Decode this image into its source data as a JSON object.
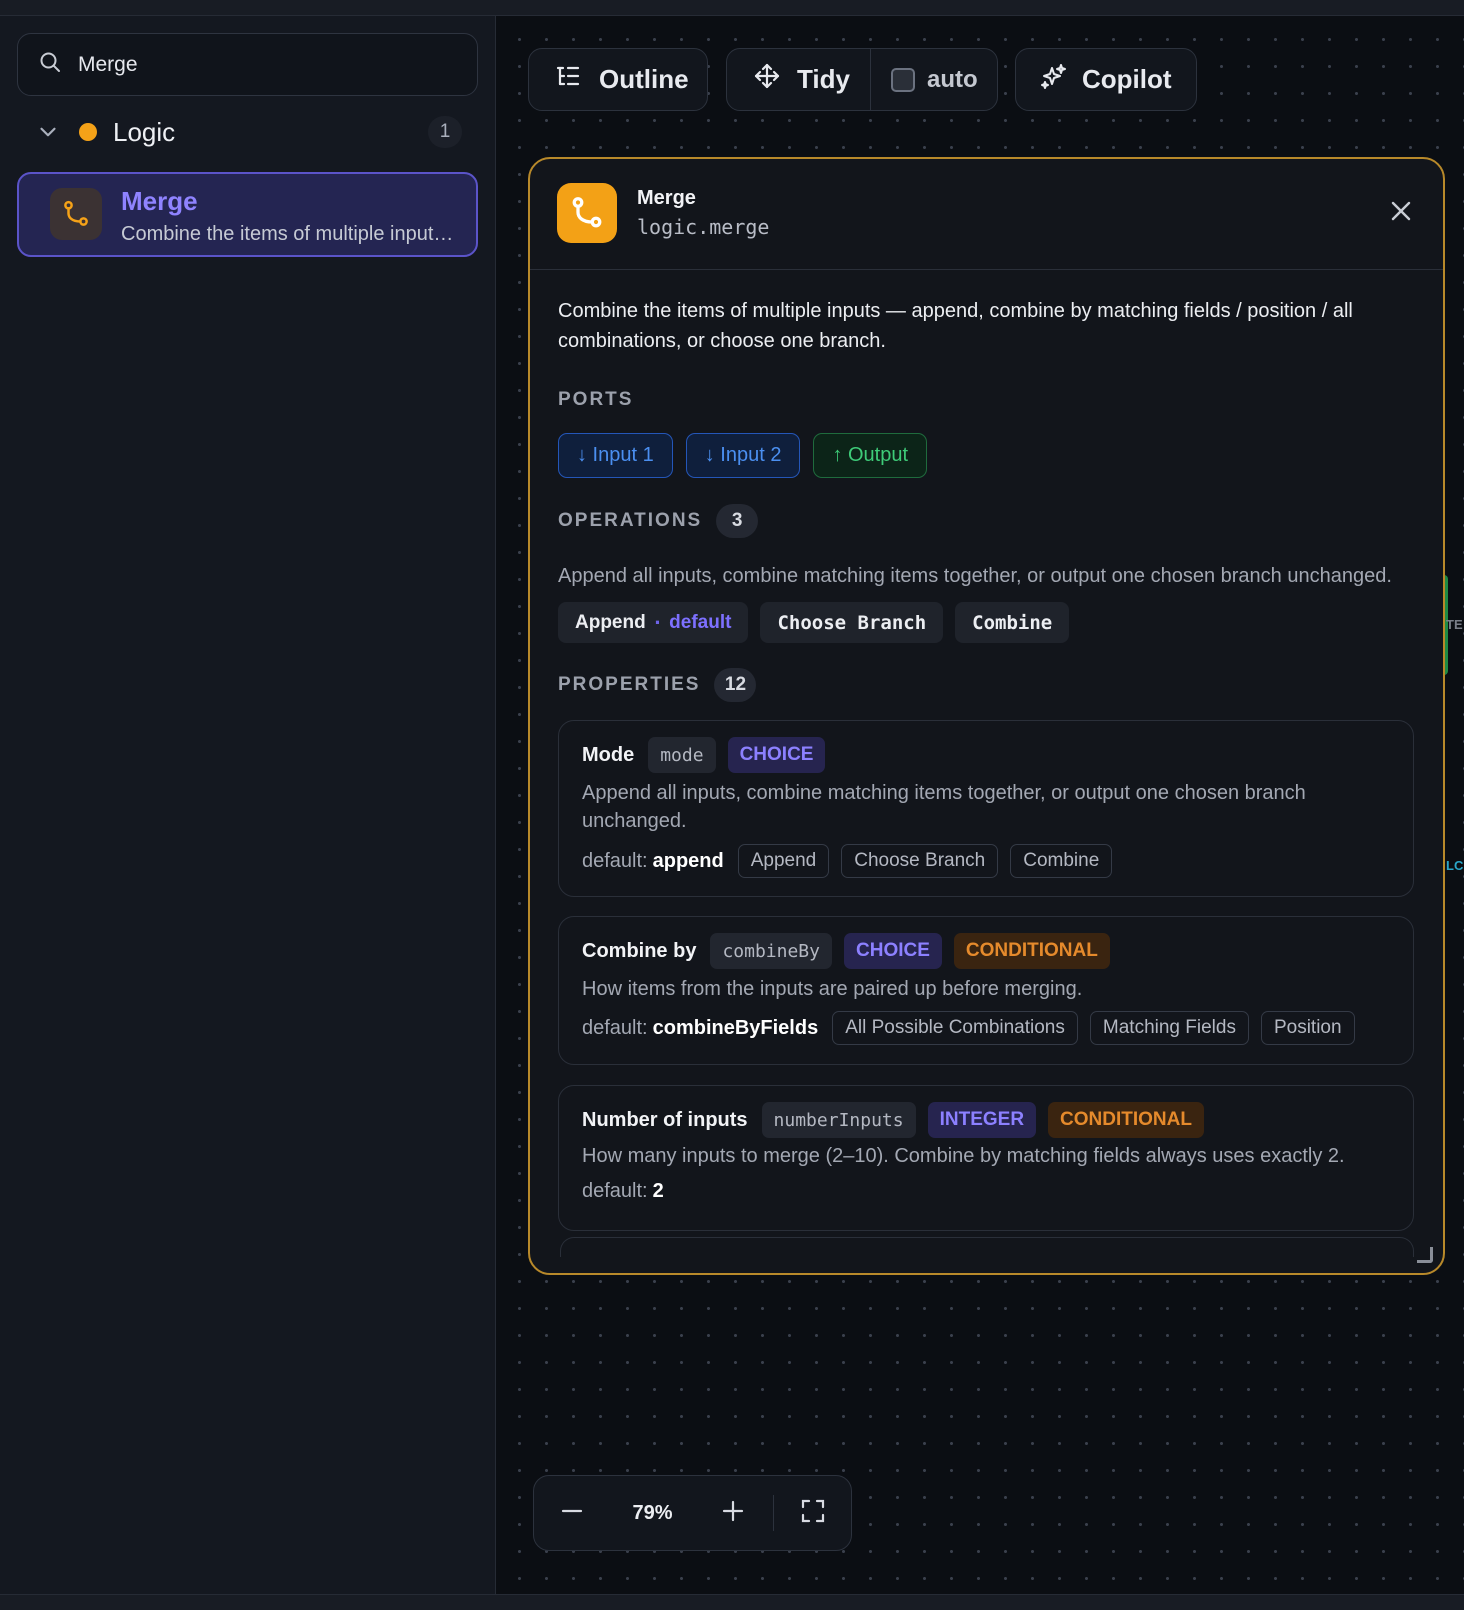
{
  "sidebar": {
    "search": {
      "value": "Merge",
      "icon": "search-icon"
    },
    "category": {
      "label": "Logic",
      "count": "1",
      "dot_color": "#f5a218"
    },
    "node": {
      "title": "Merge",
      "description": "Combine the items of multiple input…",
      "icon": "merge-icon"
    }
  },
  "toolbar": {
    "outline_label": "Outline",
    "tidy_label": "Tidy",
    "auto_label": "auto",
    "auto_checked": false,
    "copilot_label": "Copilot"
  },
  "panel": {
    "title": "Merge",
    "id": "logic.merge",
    "accent_color": "#f3a116",
    "description": "Combine the items of multiple inputs — append, combine by matching fields / position / all combinations, or choose one branch.",
    "ports_heading": "PORTS",
    "ports": {
      "input1": "↓ Input 1",
      "input2": "↓ Input 2",
      "output": "↑ Output"
    },
    "operations": {
      "heading": "OPERATIONS",
      "count": "3",
      "description": "Append all inputs, combine matching items together, or output one chosen branch unchanged.",
      "append": "Append",
      "separator": "·",
      "default_tag": "default",
      "choose_branch": "Choose Branch",
      "combine": "Combine"
    },
    "properties": {
      "heading": "PROPERTIES",
      "count": "12",
      "default_label": "default:",
      "mode": {
        "name": "Mode",
        "key": "mode",
        "type": "CHOICE",
        "description": "Append all inputs, combine matching items together, or output one chosen branch unchanged.",
        "default": "append",
        "options": [
          "Append",
          "Choose Branch",
          "Combine"
        ]
      },
      "combine_by": {
        "name": "Combine by",
        "key": "combineBy",
        "type": "CHOICE",
        "conditional": "CONDITIONAL",
        "description": "How items from the inputs are paired up before merging.",
        "default": "combineByFields",
        "options": [
          "All Possible Combinations",
          "Matching Fields",
          "Position"
        ]
      },
      "number_inputs": {
        "name": "Number of inputs",
        "key": "numberInputs",
        "type": "INTEGER",
        "conditional": "CONDITIONAL",
        "description": "How many inputs to merge (2–10). Combine by matching fields always uses exactly 2.",
        "default": "2"
      }
    }
  },
  "zoom": {
    "value": "79%"
  },
  "edge": {
    "te": "TE",
    "lo": "LC"
  }
}
